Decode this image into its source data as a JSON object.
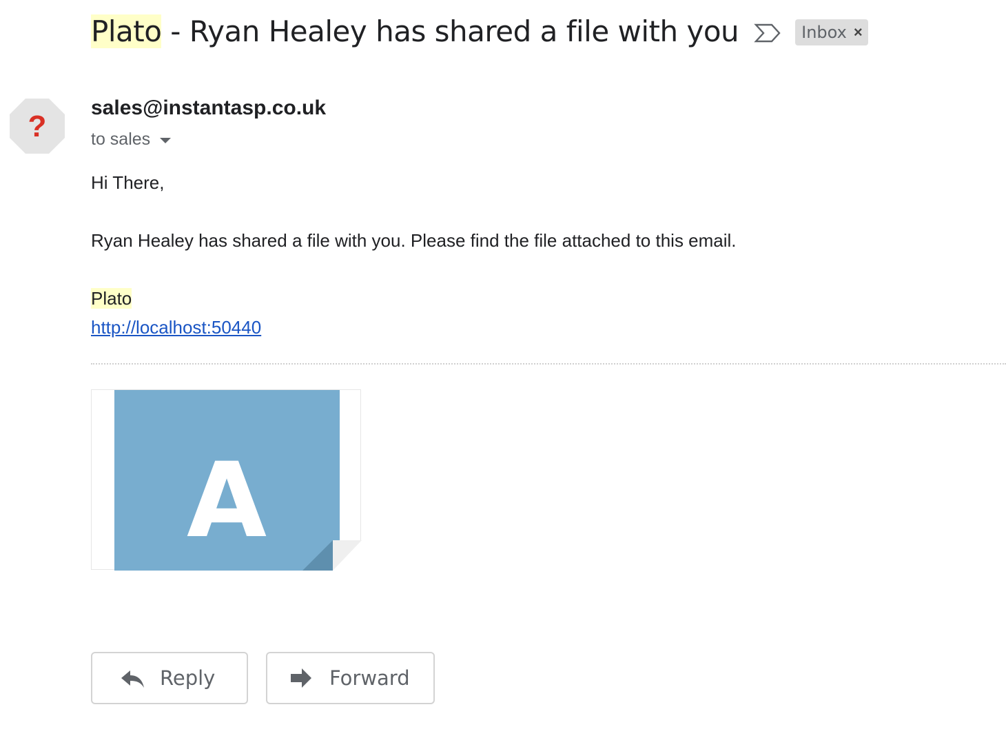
{
  "subject": {
    "highlight": "Plato",
    "rest": " - Ryan Healey has shared a file with you",
    "label": "Inbox",
    "label_close": "×"
  },
  "sender": {
    "email": "sales@instantasp.co.uk",
    "recipients": "to sales",
    "avatar_glyph": "?"
  },
  "body": {
    "greeting": "Hi There,",
    "message": "Ryan Healey has shared a file with you. Please find the file attached to this email.",
    "signature": "Plato",
    "link": "http://localhost:50440"
  },
  "attachment": {
    "letter": "A",
    "color": "#78adcf"
  },
  "actions": {
    "reply": "Reply",
    "forward": "Forward"
  },
  "icons": [
    "important-marker-icon",
    "unknown-sender-avatar",
    "caret-down-icon",
    "reply-arrow-icon",
    "forward-arrow-icon"
  ]
}
